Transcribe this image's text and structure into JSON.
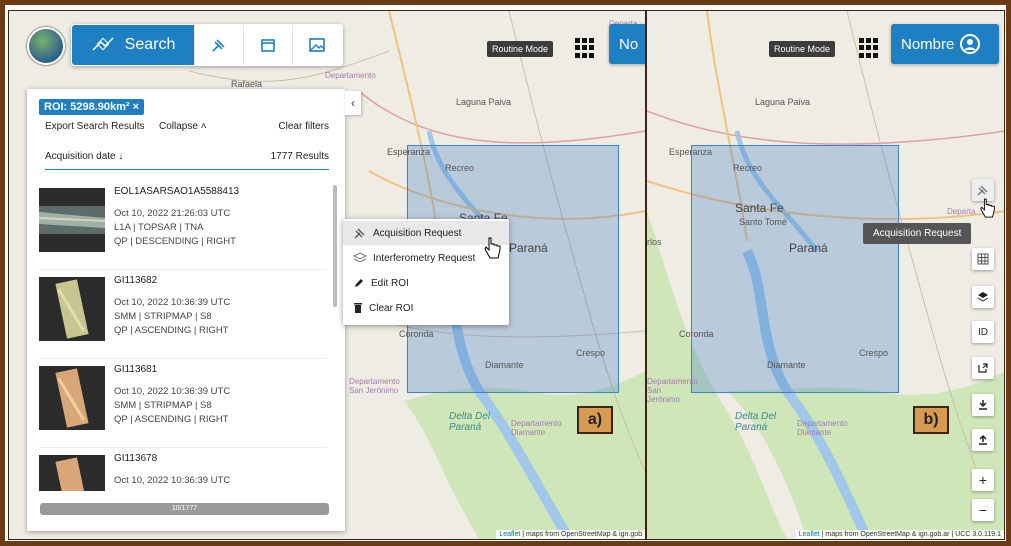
{
  "colors": {
    "accent": "#1e7fc3",
    "frame": "#6a3b16",
    "roi_fill": "rgba(70,130,200,0.32)",
    "tag": "#d59b52"
  },
  "pane_a": {
    "toolbar": {
      "search_label": "Search",
      "icons": [
        "satellite-icon",
        "calendar-icon",
        "image-icon"
      ]
    },
    "routine_mode": "Routine Mode",
    "user_button_partial": "No",
    "panel": {
      "roi_chip": "ROI: 5298.90km² ×",
      "export": "Export Search Results",
      "collapse": "Collapse ˄",
      "clear_filters": "Clear filters",
      "sort_label": "Acquisition date ↓",
      "results_count": "1777 Results",
      "results": [
        {
          "title": "EOL1ASARSAO1A5588413",
          "date": "Oct 10, 2022 21:26:03 UTC",
          "line2": "L1A | TOPSAR | TNA",
          "line3": "QP | DESCENDING | RIGHT"
        },
        {
          "title": "GI113682",
          "date": "Oct 10, 2022 10:36:39 UTC",
          "line2": "SMM | STRIPMAP | S8",
          "line3": "QP | ASCENDING | RIGHT"
        },
        {
          "title": "GI113681",
          "date": "Oct 10, 2022 10:36:39 UTC",
          "line2": "SMM | STRIPMAP | S8",
          "line3": "QP | ASCENDING | RIGHT"
        },
        {
          "title": "GI113678",
          "date": "Oct 10, 2022 10:36:39 UTC",
          "line2": "",
          "line3": ""
        }
      ],
      "progress": "10/1777",
      "progress_fraction": 0.0056
    },
    "context_menu": [
      {
        "label": "Acquisition Request",
        "icon": "satellite-icon",
        "active": true
      },
      {
        "label": "Interferometry Request",
        "icon": "layers-icon",
        "active": false
      },
      {
        "label": "Edit ROI",
        "icon": "pencil-icon",
        "active": false
      },
      {
        "label": "Clear ROI",
        "icon": "trash-icon",
        "active": false
      }
    ],
    "tag": "a)",
    "attribution": {
      "leaflet": "Leaflet",
      "rest": " | maps from OpenStreetMap & ign.gob"
    }
  },
  "pane_b": {
    "routine_mode": "Routine Mode",
    "user_button": "Nombre",
    "tooltip": "Acquisition Request",
    "side_buttons": [
      "satellite-icon",
      "grid-icon",
      "layers-icon",
      "ID",
      "export-icon",
      "download-icon",
      "upload-icon",
      "+",
      "−"
    ],
    "tag": "b)",
    "attribution": {
      "leaflet": "Leaflet",
      "rest": " | maps from OpenStreetMap & ign.gob.ar | UCC 3.0.119.1"
    }
  },
  "map_labels": {
    "laguna": "Laguna Paiva",
    "esperanza": "Esperanza",
    "recreo": "Recreo",
    "santa_fe": "Santa Fe",
    "santo_tome": "Santo Tomé",
    "parana": "Paraná",
    "coronda": "Coronda",
    "crespo": "Crespo",
    "diamante": "Diamante",
    "delta": "Delta Del Paraná",
    "dept_sj": "Departamento San Jerónimo",
    "dept_diamante": "Departamento Diamante",
    "dept_gc": "Departamento",
    "rafaela": "Rafaela",
    "dep_right": "Departa",
    "dept_b": "Departa",
    "carlos": "rlos"
  }
}
